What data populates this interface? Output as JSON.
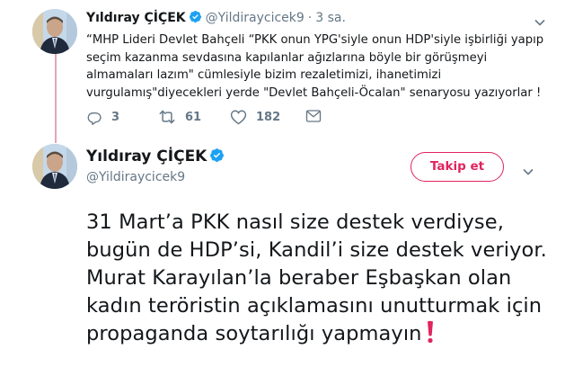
{
  "tweet_reply": {
    "author_name": "Yıldıray ÇİÇEK",
    "handle": "@Yildiraycicek9",
    "separator": "·",
    "time": "3 sa.",
    "text": "“MHP Lideri Devlet Bahçeli “PKK onun YPG'siyle onun HDP'siyle işbirliği yapıp seçim kazanma sevdasına kapılanlar ağızlarına böyle bir görüşmeyi almamaları lazım\" cümlesiyle bizim rezaletimizi, ihanetimizi vurgulamış\"diyecekleri yerde \"Devlet Bahçeli-Öcalan\" senaryosu yazıyorlar !",
    "actions": {
      "reply_count": "3",
      "retweet_count": "61",
      "like_count": "182"
    }
  },
  "tweet_main": {
    "author_name": "Yıldıray ÇİÇEK",
    "handle": "@Yildiraycicek9",
    "follow_label": "Takip et",
    "text": "31 Mart’a PKK nasıl size destek verdiyse, bugün de HDP’si, Kandil’i size destek veriyor. Murat Karayılan’la beraber Eşbaşkan olan kadın teröristin açıklamasını unutturmak için propaganda soytarılığı yapmayın",
    "emoji": "exclamation-mark-icon"
  },
  "colors": {
    "verified": "#1da1f2",
    "follow": "#e0245e",
    "muted": "#657786",
    "thread_line": "#e5a3b6",
    "exclamation": "#e0245e"
  }
}
